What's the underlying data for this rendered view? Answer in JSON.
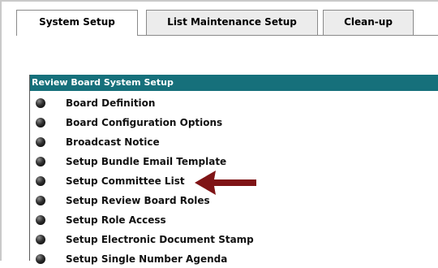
{
  "tabs": [
    {
      "label": "System Setup",
      "active": true
    },
    {
      "label": "List Maintenance Setup",
      "active": false
    },
    {
      "label": "Clean-up",
      "active": false
    }
  ],
  "panel": {
    "title": "Review Board System Setup",
    "items": [
      {
        "label": "Board Definition"
      },
      {
        "label": "Board Configuration Options"
      },
      {
        "label": "Broadcast Notice"
      },
      {
        "label": "Setup Bundle Email Template"
      },
      {
        "label": "Setup Committee List"
      },
      {
        "label": "Setup Review Board Roles"
      },
      {
        "label": "Setup Role Access"
      },
      {
        "label": "Setup Electronic Document Stamp"
      },
      {
        "label": "Setup Single Number Agenda"
      }
    ]
  },
  "annotation": {
    "icon": "left-arrow-icon",
    "color": "#7f1416",
    "points_to": "Setup Committee List"
  },
  "colors": {
    "header_bg": "#16707b",
    "header_text": "#ffffff",
    "bullet": "#2e2e2e"
  }
}
